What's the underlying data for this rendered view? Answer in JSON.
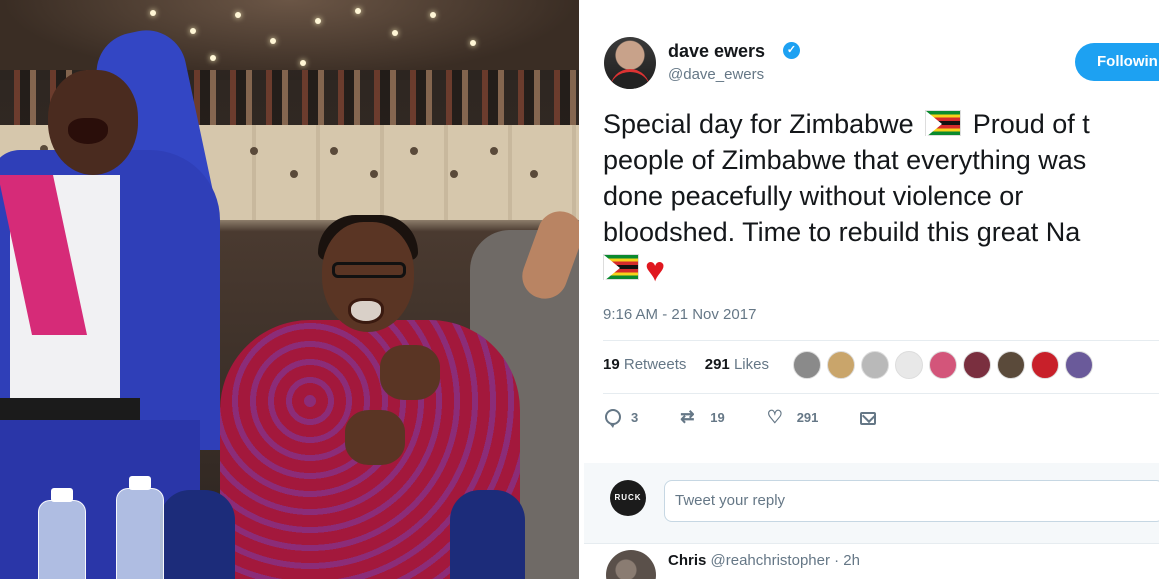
{
  "photo": {
    "alt": "people celebrating in parliament"
  },
  "tweet": {
    "author": {
      "name": "dave ewers",
      "handle": "@dave_ewers",
      "verified": true
    },
    "follow_button_label": "Followin",
    "text_lines": [
      "Special day for Zimbabwe",
      "Proud of t",
      "people of Zimbabwe that everything was",
      "done peacefully without violence or",
      "bloodshed. Time to rebuild this great Na"
    ],
    "emoji": [
      "zimbabwe-flag",
      "zimbabwe-flag",
      "red-heart"
    ],
    "timestamp": "9:16 AM - 21 Nov 2017",
    "retweets_count": "19",
    "retweets_label": "Retweets",
    "likes_count": "291",
    "likes_label": "Likes",
    "liker_avatar_colors": [
      "#8a8a8a",
      "#c9a56b",
      "#b9b9b9",
      "#e8e8e8",
      "#d3557a",
      "#7a2f3f",
      "#5a4a3a",
      "#c8202a",
      "#6a5a9a"
    ],
    "actions": {
      "reply_count": "3",
      "retweet_count": "19",
      "like_count": "291"
    },
    "reply_box": {
      "avatar_text": "RUCK",
      "placeholder": "Tweet your reply"
    },
    "comment": {
      "name": "Chris",
      "handle": "@reahchristopher",
      "time": "· 2h"
    }
  },
  "colors": {
    "twitter_blue": "#1da1f2",
    "text_dark": "#14171a",
    "text_gray": "#657786",
    "heart_red": "#e0171f"
  }
}
